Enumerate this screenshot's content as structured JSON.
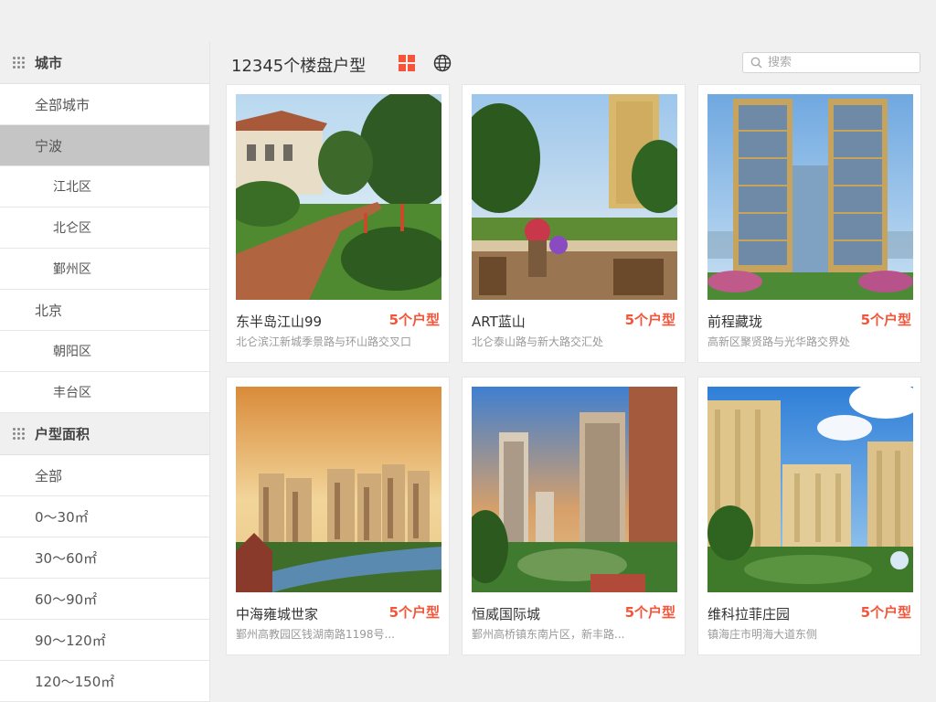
{
  "sidebar": {
    "city_header": "城市",
    "city_items": {
      "all": "全部城市",
      "ningbo": "宁波",
      "jiangbei": "江北区",
      "beilun": "北仑区",
      "yinzhou": "鄞州区",
      "beijing": "北京",
      "chaoyang": "朝阳区",
      "fengtai": "丰台区"
    },
    "area_header": "户型面积",
    "area_items": {
      "all": "全部",
      "a1": "0～30㎡",
      "a2": "30～60㎡",
      "a3": "60～90㎡",
      "a4": "90～120㎡",
      "a5": "120～150㎡"
    }
  },
  "header": {
    "title": "12345个楼盘户型",
    "search_placeholder": "搜索"
  },
  "icons": {
    "grid": "grid-view-icon",
    "globe": "globe-icon",
    "search": "search-icon",
    "menu": "dots-grid-icon"
  },
  "colors": {
    "accent": "#f4553a",
    "active_item": "#c5c5c5"
  },
  "listings": [
    {
      "name": "东半岛江山99",
      "units": "5个户型",
      "address": "北仑滨江新城季景路与环山路交叉口"
    },
    {
      "name": "ART蓝山",
      "units": "5个户型",
      "address": "北仑泰山路与新大路交汇处"
    },
    {
      "name": "前程藏珑",
      "units": "5个户型",
      "address": "高新区聚贤路与光华路交界处"
    },
    {
      "name": "中海雍城世家",
      "units": "5个户型",
      "address": "鄞州高教园区钱湖南路1198号..."
    },
    {
      "name": "恒威国际城",
      "units": "5个户型",
      "address": "鄞州高桥镇东南片区，新丰路..."
    },
    {
      "name": "维科拉菲庄园",
      "units": "5个户型",
      "address": "镇海庄市明海大道东侧"
    }
  ]
}
